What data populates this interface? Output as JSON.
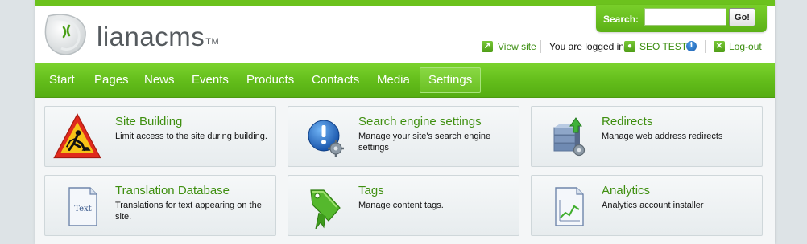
{
  "logo": {
    "text": "lianacms",
    "tm": "TM"
  },
  "search": {
    "label": "Search:",
    "value": "",
    "button": "Go!"
  },
  "userbar": {
    "view_site": "View site",
    "logged_in_label": "You are logged in:",
    "user_name": "SEO TEST",
    "logout": "Log-out"
  },
  "nav": {
    "items": [
      {
        "label": "Start"
      },
      {
        "label": "Pages"
      },
      {
        "label": "News"
      },
      {
        "label": "Events"
      },
      {
        "label": "Products"
      },
      {
        "label": "Contacts"
      },
      {
        "label": "Media"
      },
      {
        "label": "Settings",
        "active": true
      }
    ]
  },
  "cards": [
    {
      "title": "Site Building",
      "desc": "Limit access to the site during building.",
      "icon": "construction-sign-icon"
    },
    {
      "title": "Search engine settings",
      "desc": "Manage your site's search engine settings",
      "icon": "search-engine-settings-icon"
    },
    {
      "title": "Redirects",
      "desc": "Manage web address redirects",
      "icon": "redirect-server-icon"
    },
    {
      "title": "Translation Database",
      "desc": "Translations for text appearing on the site.",
      "icon": "text-document-icon",
      "icon_text": "Text"
    },
    {
      "title": "Tags",
      "desc": "Manage content tags.",
      "icon": "tag-icon"
    },
    {
      "title": "Analytics",
      "desc": "Analytics account installer",
      "icon": "analytics-chart-icon"
    }
  ],
  "colors": {
    "brand_green": "#6cc21d",
    "link_green": "#3f8f10"
  }
}
